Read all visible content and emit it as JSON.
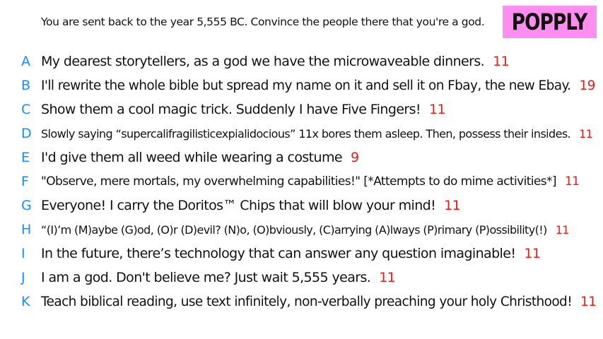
{
  "prompt": "You are sent back to the year 5,555 BC. Convince the people there that you're a god.",
  "logo": "POPPLY",
  "colors": {
    "letter": "#1a8cff",
    "score": "#e0201c",
    "logo_bg": "#ff8ef0"
  },
  "answers": [
    {
      "letter": "A",
      "text": "My dearest storytellers, as a god we have the microwaveable dinners.",
      "score": "11"
    },
    {
      "letter": "B",
      "text": "I'll rewrite the whole bible but spread my name on it and sell it on Fbay, the new Ebay.",
      "score": "19"
    },
    {
      "letter": "C",
      "text": "Show them a cool magic trick. Suddenly I have Five Fingers!",
      "score": "11"
    },
    {
      "letter": "D",
      "text": "Slowly saying “supercalifragilisticexpialidocious” 11x bores them asleep. Then, possess their insides.",
      "score": "11"
    },
    {
      "letter": "E",
      "text": "I'd give them all weed while wearing a costume",
      "score": "9"
    },
    {
      "letter": "F",
      "text": "\"Observe, mere mortals, my overwhelming capabilities!\" [*Attempts to do mime activities*]",
      "score": "11"
    },
    {
      "letter": "G",
      "text": "Everyone! I carry the Doritos™ Chips that will blow your mind!",
      "score": "11"
    },
    {
      "letter": "H",
      "text": "“(I)’m (M)aybe (G)od, (O)r (D)evil? (N)o,  (O)bviously, (C)arrying (A)lways (P)rimary (P)ossibility(!)",
      "score": "11"
    },
    {
      "letter": "I",
      "text": "In the future, there’s technology that can answer any question imaginable!",
      "score": "11"
    },
    {
      "letter": "J",
      "text": "I am a god. Don't believe me? Just wait 5,555 years.",
      "score": "11"
    },
    {
      "letter": "K",
      "text": "Teach biblical reading, use text infinitely, non-verbally preaching your holy Christhood!",
      "score": "11"
    }
  ]
}
